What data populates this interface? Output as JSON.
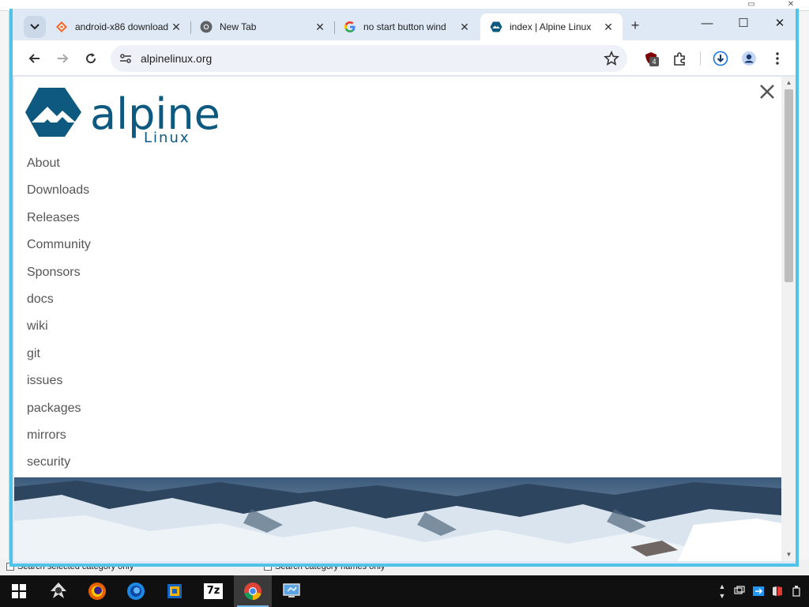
{
  "background_app": {
    "checkbox1_label": "Search selected category only",
    "checkbox2_label": "Search category names only"
  },
  "browser": {
    "tabs": [
      {
        "title": "android-x86 download",
        "favicon": "sourceforge-icon"
      },
      {
        "title": "New Tab",
        "favicon": "chrome-icon"
      },
      {
        "title": "no start button wind",
        "favicon": "google-icon"
      },
      {
        "title": "index | Alpine Linux",
        "favicon": "alpine-icon",
        "active": true
      }
    ],
    "url": "alpinelinux.org",
    "extension_badge": "4"
  },
  "page": {
    "logo_text": "alpine",
    "logo_subtext": "Linux",
    "nav": [
      "About",
      "Downloads",
      "Releases",
      "Community",
      "Sponsors",
      "docs",
      "wiki",
      "git",
      "issues",
      "packages",
      "mirrors",
      "security"
    ]
  },
  "taskbar": {
    "apps": [
      "start",
      "inkscape",
      "firefox",
      "firefox-developer",
      "virtualbox",
      "7zip",
      "chrome",
      "remote-desktop"
    ],
    "active_app": "chrome",
    "seven_zip_label": "7z"
  },
  "colors": {
    "accent": "#4fc3e8",
    "alpine_blue": "#0d597f",
    "tabstrip": "#dfe9f5"
  }
}
